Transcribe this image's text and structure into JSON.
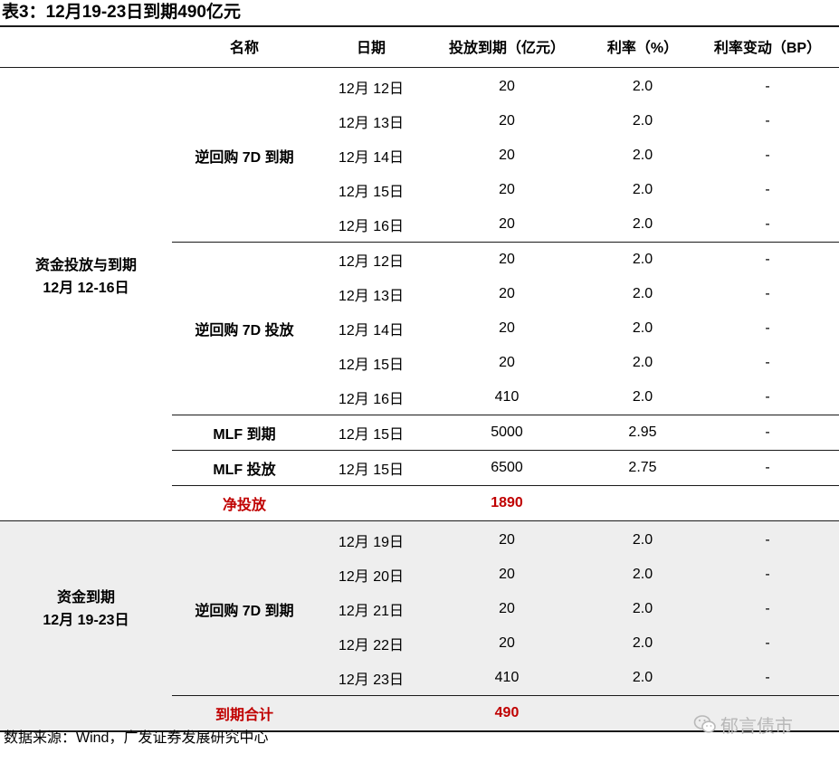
{
  "title": "表3：12月19-23日到期490亿元",
  "headers": [
    "名称",
    "日期",
    "投放到期（亿元）",
    "利率（%）",
    "利率变动（BP）"
  ],
  "section1": {
    "group_line1": "资金投放与到期",
    "group_line2": "12月 12-16日",
    "blocks": [
      {
        "name": "逆回购 7D 到期",
        "rows": [
          [
            "12月 12日",
            "20",
            "2.0",
            "-"
          ],
          [
            "12月 13日",
            "20",
            "2.0",
            "-"
          ],
          [
            "12月 14日",
            "20",
            "2.0",
            "-"
          ],
          [
            "12月 15日",
            "20",
            "2.0",
            "-"
          ],
          [
            "12月 16日",
            "20",
            "2.0",
            "-"
          ]
        ]
      },
      {
        "name": "逆回购 7D 投放",
        "rows": [
          [
            "12月 12日",
            "20",
            "2.0",
            "-"
          ],
          [
            "12月 13日",
            "20",
            "2.0",
            "-"
          ],
          [
            "12月 14日",
            "20",
            "2.0",
            "-"
          ],
          [
            "12月 15日",
            "20",
            "2.0",
            "-"
          ],
          [
            "12月 16日",
            "410",
            "2.0",
            "-"
          ]
        ]
      },
      {
        "name": "MLF 到期",
        "rows": [
          [
            "12月 15日",
            "5000",
            "2.95",
            "-"
          ]
        ]
      },
      {
        "name": "MLF 投放",
        "rows": [
          [
            "12月 15日",
            "6500",
            "2.75",
            "-"
          ]
        ]
      }
    ],
    "summary_label": "净投放",
    "summary_value": "1890"
  },
  "section2": {
    "group_line1": "资金到期",
    "group_line2": "12月 19-23日",
    "blocks": [
      {
        "name": "逆回购 7D 到期",
        "rows": [
          [
            "12月 19日",
            "20",
            "2.0",
            "-"
          ],
          [
            "12月 20日",
            "20",
            "2.0",
            "-"
          ],
          [
            "12月 21日",
            "20",
            "2.0",
            "-"
          ],
          [
            "12月 22日",
            "20",
            "2.0",
            "-"
          ],
          [
            "12月 23日",
            "410",
            "2.0",
            "-"
          ]
        ]
      }
    ],
    "summary_label": "到期合计",
    "summary_value": "490"
  },
  "source": "数据来源：Wind，广发证券发展研究中心",
  "watermark": "郁言债市",
  "colors": {
    "accent_red": "#c00000",
    "shade": "#eeeeee"
  }
}
